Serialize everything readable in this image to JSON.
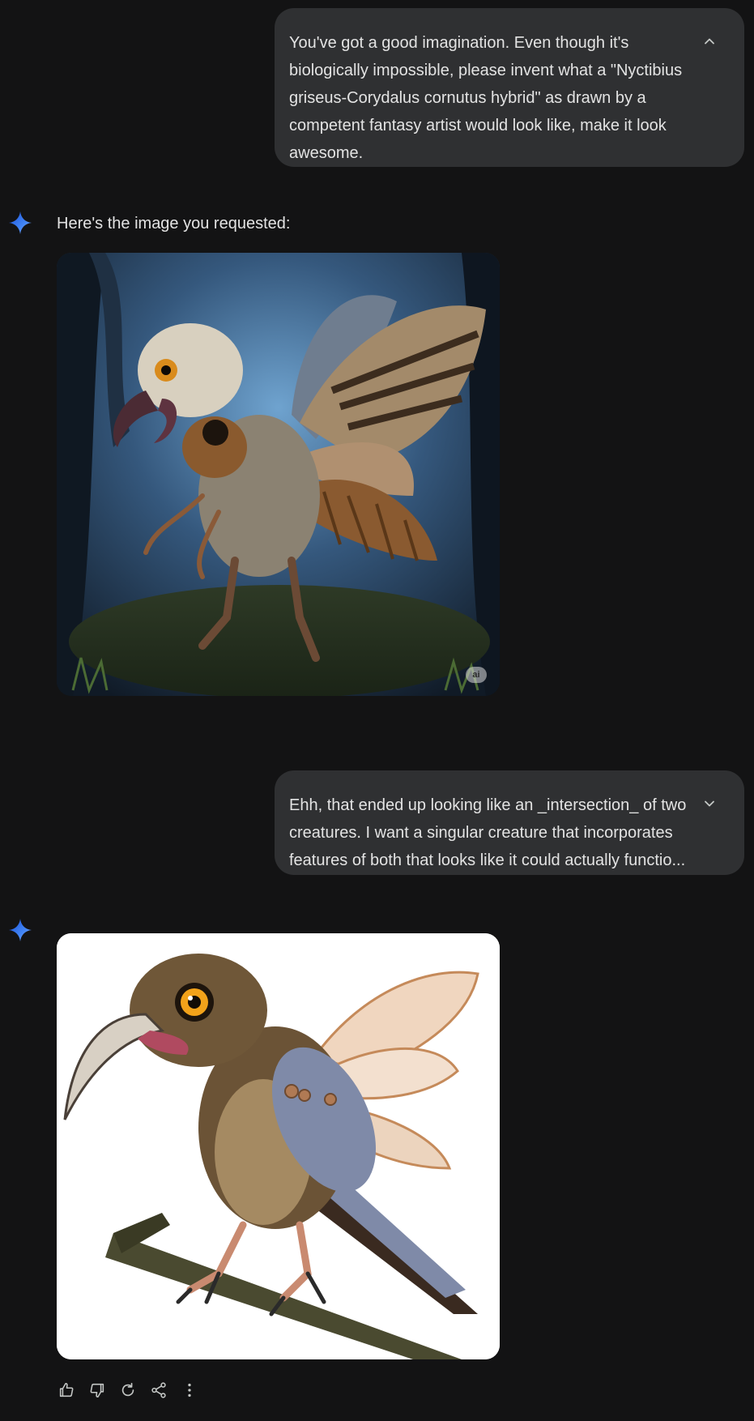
{
  "conversation": {
    "user_messages": [
      {
        "text": "You've got a good imagination. Even though it's biologically impossible, please invent what a \"Nyctibius griseus-Corydalus cornutus hybrid\" as drawn by a competent fantasy artist would look like, make it look awesome.",
        "toggle_icon": "chevron-up-icon"
      },
      {
        "text": "Ehh, that ended up looking like an _intersection_ of two creatures. I want a singular creature that incorporates features of both that looks like it could actually functio...",
        "toggle_icon": "chevron-down-icon"
      }
    ],
    "responses": [
      {
        "text": "Here's the image you requested:",
        "image_badge": "ai"
      },
      {
        "text": ""
      }
    ]
  },
  "actions": {
    "icons": [
      "thumbs-up-icon",
      "thumbs-down-icon",
      "regenerate-icon",
      "share-icon",
      "more-options-icon"
    ]
  },
  "colors": {
    "background": "#131314",
    "user_bubble": "#2f3032",
    "text": "#e3e3e3",
    "icon": "#c4c7c5",
    "gemini_accent": "#4285f4"
  }
}
